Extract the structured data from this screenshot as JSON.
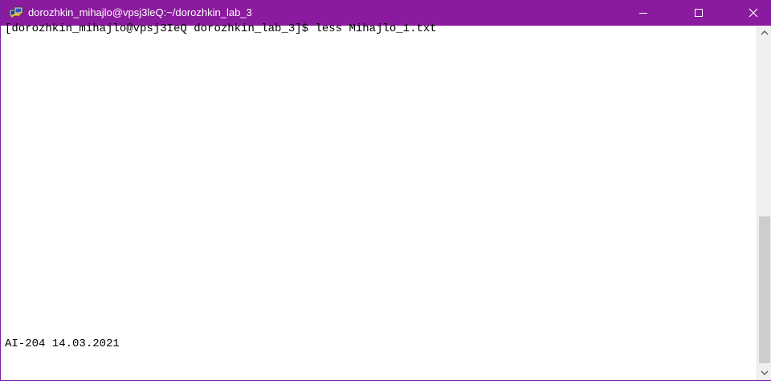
{
  "window": {
    "title": "dorozhkin_mihajlo@vpsj3leQ:~/dorozhkin_lab_3",
    "icon": "putty-icon",
    "accent_color": "#8a1a9e"
  },
  "terminal": {
    "command_line": "[dorozhkin_mihajlo@vpsj3IeQ dorozhkin_lab_3]$ less Mihajlo_1.txt",
    "status_line": "AI-204 14.03.2021"
  },
  "controls": [
    "minimize-icon",
    "maximize-icon",
    "close-icon"
  ]
}
